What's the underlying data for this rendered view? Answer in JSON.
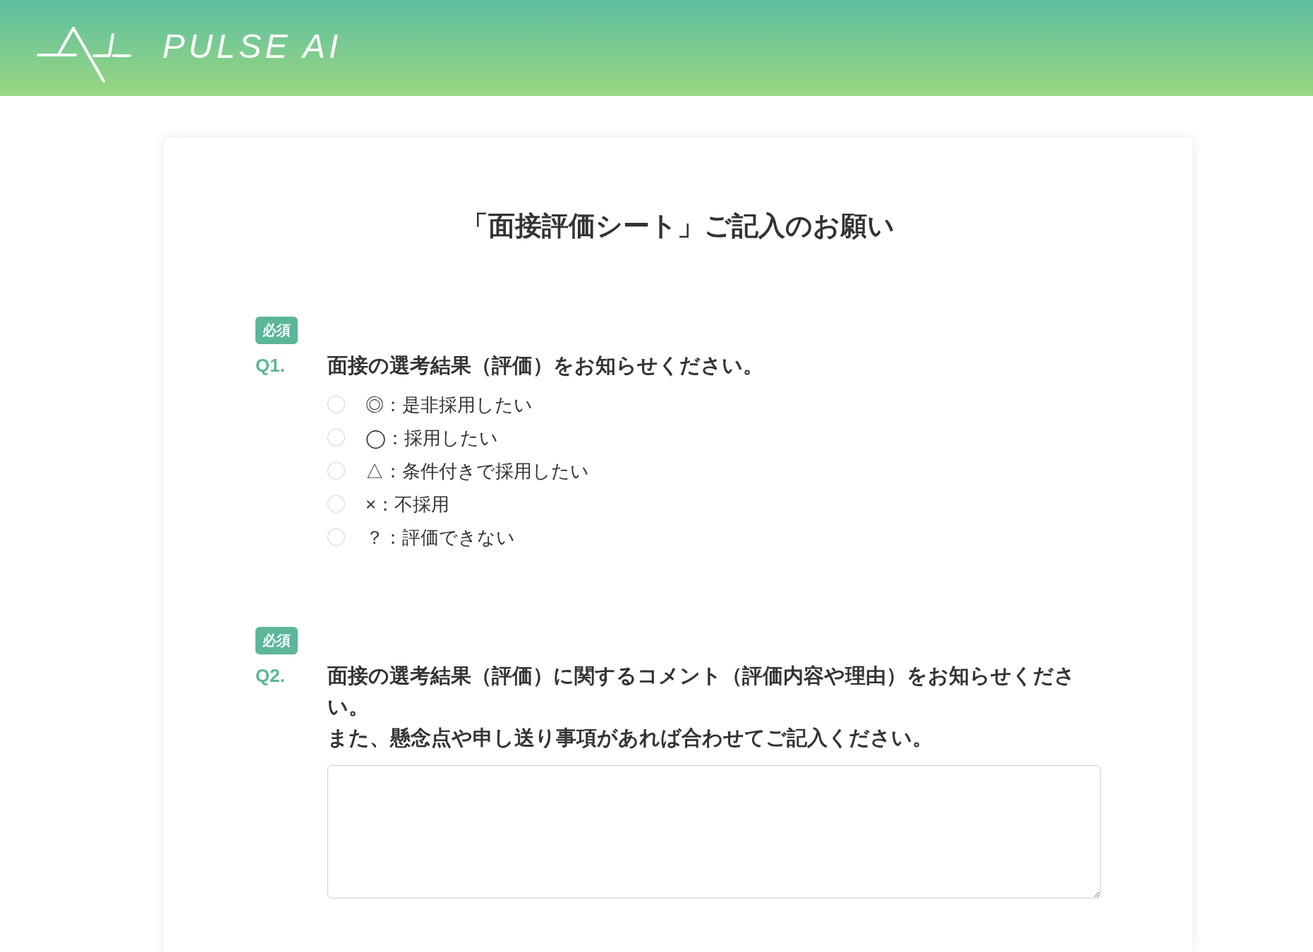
{
  "header": {
    "logo_text": "PULSE AI"
  },
  "form": {
    "title": "「面接評価シート」ご記入のお願い",
    "questions": [
      {
        "kind": "choice",
        "badge": "必須",
        "number": "Q1.",
        "text_lines": [
          "面接の選考結果（評価）をお知らせください。"
        ],
        "options": [
          {
            "label": "◎：是非採用したい",
            "selected": false
          },
          {
            "label": "◯：採用したい",
            "selected": false
          },
          {
            "label": "△：条件付きで採用したい",
            "selected": false
          },
          {
            "label": "×：不採用",
            "selected": false
          },
          {
            "label": "？：評価できない",
            "selected": false
          }
        ]
      },
      {
        "kind": "text",
        "badge": "必須",
        "number": "Q2.",
        "text_lines": [
          "面接の選考結果（評価）に関するコメント（評価内容や理由）をお知らせください。",
          "また、懸念点や申し送り事項があれば合わせてご記入ください。"
        ]
      }
    ]
  }
}
